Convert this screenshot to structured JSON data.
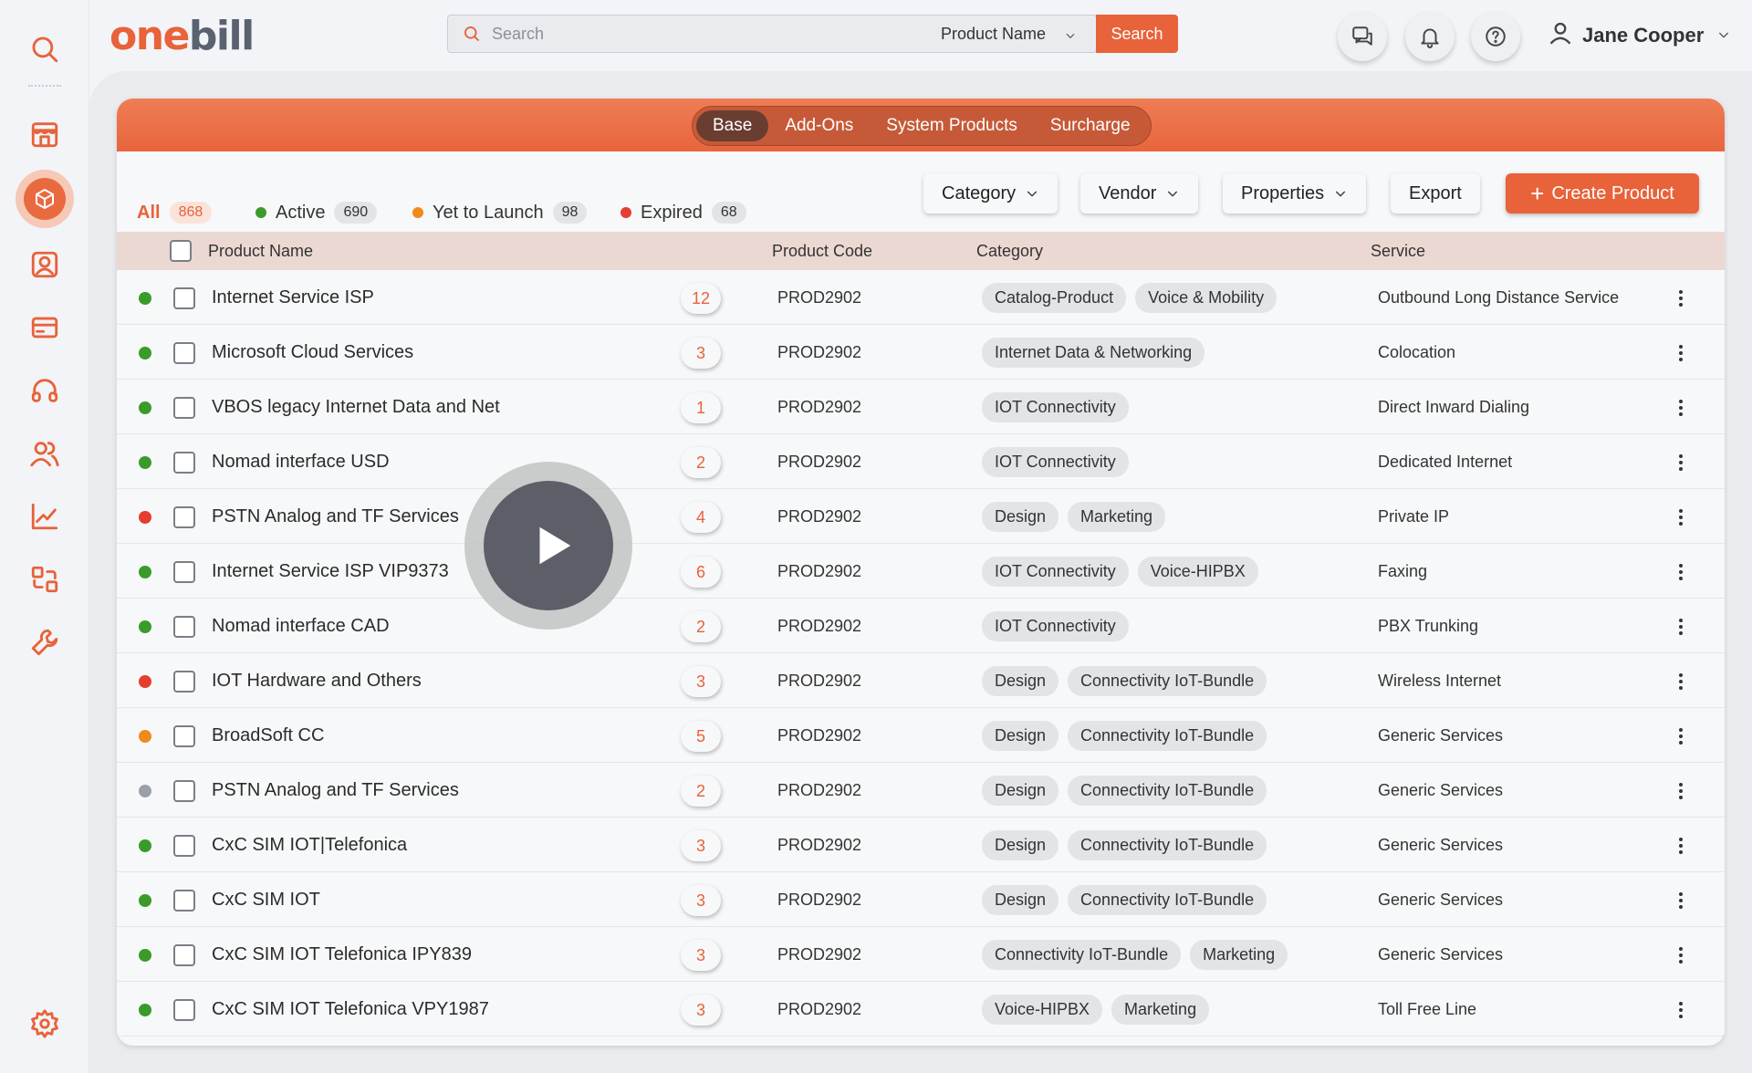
{
  "brand": {
    "part1": "one",
    "part2": "bill"
  },
  "search": {
    "placeholder": "Search",
    "type_selected": "Product Name",
    "button": "Search"
  },
  "user": {
    "name": "Jane Cooper"
  },
  "sidebar": {
    "icons": [
      "search-icon",
      "storefront-icon",
      "product-box-icon",
      "customer-card-icon",
      "billing-card-icon",
      "support-headset-icon",
      "users-icon",
      "analytics-icon",
      "integrations-icon",
      "tools-icon",
      "settings-icon"
    ],
    "active": "product-box-icon"
  },
  "segments": [
    "Base",
    "Add-Ons",
    "System Products",
    "Surcharge"
  ],
  "status_tabs": [
    {
      "label": "All",
      "count": "868",
      "color": ""
    },
    {
      "label": "Active",
      "count": "690",
      "color": "#3a9b2a"
    },
    {
      "label": "Yet to Launch",
      "count": "98",
      "color": "#f08a1c"
    },
    {
      "label": "Expired",
      "count": "68",
      "color": "#e53d2e"
    }
  ],
  "actions": {
    "category": "Category",
    "vendor": "Vendor",
    "properties": "Properties",
    "export": "Export",
    "create": "Create Product"
  },
  "columns": {
    "name": "Product Name",
    "code": "Product Code",
    "category": "Category",
    "service": "Service"
  },
  "status_colors": {
    "active": "#3a9b2a",
    "expired": "#e53d2e",
    "launch": "#f08a1c",
    "draft": "#9aa0aa"
  },
  "rows": [
    {
      "status": "active",
      "name": "Internet Service ISP",
      "count": "12",
      "code": "PROD2902",
      "tags": [
        "Catalog-Product",
        "Voice & Mobility"
      ],
      "service": "Outbound Long Distance Service"
    },
    {
      "status": "active",
      "name": "Microsoft Cloud Services",
      "count": "3",
      "code": "PROD2902",
      "tags": [
        "Internet Data & Networking"
      ],
      "service": "Colocation"
    },
    {
      "status": "active",
      "name": "VBOS legacy Internet Data and Net",
      "count": "1",
      "code": "PROD2902",
      "tags": [
        "IOT Connectivity"
      ],
      "service": "Direct Inward Dialing"
    },
    {
      "status": "active",
      "name": "Nomad interface USD",
      "count": "2",
      "code": "PROD2902",
      "tags": [
        "IOT Connectivity"
      ],
      "service": "Dedicated Internet"
    },
    {
      "status": "expired",
      "name": "PSTN Analog and TF Services",
      "count": "4",
      "code": "PROD2902",
      "tags": [
        "Design",
        "Marketing"
      ],
      "service": "Private IP"
    },
    {
      "status": "active",
      "name": "Internet Service ISP VIP9373",
      "count": "6",
      "code": "PROD2902",
      "tags": [
        "IOT Connectivity",
        "Voice-HIPBX"
      ],
      "service": "Faxing"
    },
    {
      "status": "active",
      "name": "Nomad interface CAD",
      "count": "2",
      "code": "PROD2902",
      "tags": [
        "IOT Connectivity"
      ],
      "service": "PBX Trunking"
    },
    {
      "status": "expired",
      "name": "IOT Hardware and Others",
      "count": "3",
      "code": "PROD2902",
      "tags": [
        "Design",
        "Connectivity IoT-Bundle"
      ],
      "service": "Wireless Internet"
    },
    {
      "status": "launch",
      "name": "BroadSoft CC",
      "count": "5",
      "code": "PROD2902",
      "tags": [
        "Design",
        "Connectivity IoT-Bundle"
      ],
      "service": "Generic Services"
    },
    {
      "status": "draft",
      "name": "PSTN Analog and TF Services",
      "count": "2",
      "code": "PROD2902",
      "tags": [
        "Design",
        "Connectivity IoT-Bundle"
      ],
      "service": "Generic Services"
    },
    {
      "status": "active",
      "name": "CxC SIM IOT|Telefonica",
      "count": "3",
      "code": "PROD2902",
      "tags": [
        "Design",
        "Connectivity IoT-Bundle"
      ],
      "service": "Generic Services"
    },
    {
      "status": "active",
      "name": "CxC SIM IOT",
      "count": "3",
      "code": "PROD2902",
      "tags": [
        "Design",
        "Connectivity IoT-Bundle"
      ],
      "service": "Generic Services"
    },
    {
      "status": "active",
      "name": "CxC SIM IOT Telefonica IPY839",
      "count": "3",
      "code": "PROD2902",
      "tags": [
        "Connectivity IoT-Bundle",
        "Marketing"
      ],
      "service": "Generic Services"
    },
    {
      "status": "active",
      "name": "CxC SIM IOT Telefonica VPY1987",
      "count": "3",
      "code": "PROD2902",
      "tags": [
        "Voice-HIPBX",
        "Marketing"
      ],
      "service": "Toll Free Line"
    }
  ]
}
